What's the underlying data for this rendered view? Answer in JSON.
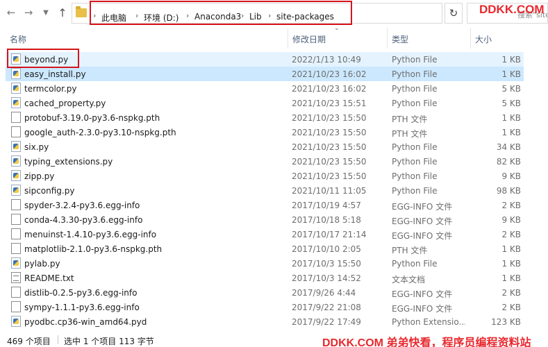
{
  "address_bar": {
    "crumbs": [
      "此电脑",
      "环境 (D:)",
      "Anaconda3",
      "Lib",
      "site-packages"
    ],
    "search_placeholder": "搜索\"site-pa"
  },
  "watermark_top": "DDKK.COM",
  "columns": {
    "name": "名称",
    "date": "修改日期",
    "type": "类型",
    "size": "大小"
  },
  "files": [
    {
      "name": "beyond.py",
      "date": "2022/1/13 10:49",
      "type": "Python File",
      "size": "1 KB",
      "icon": "python-file-icon",
      "state": "hover"
    },
    {
      "name": "easy_install.py",
      "date": "2021/10/23 16:02",
      "type": "Python File",
      "size": "1 KB",
      "icon": "python-file-icon",
      "state": "selected"
    },
    {
      "name": "termcolor.py",
      "date": "2021/10/23 16:02",
      "type": "Python File",
      "size": "5 KB",
      "icon": "python-file-icon"
    },
    {
      "name": "cached_property.py",
      "date": "2021/10/23 15:51",
      "type": "Python File",
      "size": "5 KB",
      "icon": "python-file-icon"
    },
    {
      "name": "protobuf-3.19.0-py3.6-nspkg.pth",
      "date": "2021/10/23 15:50",
      "type": "PTH 文件",
      "size": "1 KB",
      "icon": "blank-file-icon"
    },
    {
      "name": "google_auth-2.3.0-py3.10-nspkg.pth",
      "date": "2021/10/23 15:50",
      "type": "PTH 文件",
      "size": "1 KB",
      "icon": "blank-file-icon"
    },
    {
      "name": "six.py",
      "date": "2021/10/23 15:50",
      "type": "Python File",
      "size": "34 KB",
      "icon": "python-file-icon"
    },
    {
      "name": "typing_extensions.py",
      "date": "2021/10/23 15:50",
      "type": "Python File",
      "size": "82 KB",
      "icon": "python-file-icon"
    },
    {
      "name": "zipp.py",
      "date": "2021/10/23 15:50",
      "type": "Python File",
      "size": "9 KB",
      "icon": "python-file-icon"
    },
    {
      "name": "sipconfig.py",
      "date": "2021/10/11 11:05",
      "type": "Python File",
      "size": "98 KB",
      "icon": "python-file-icon"
    },
    {
      "name": "spyder-3.2.4-py3.6.egg-info",
      "date": "2017/10/19 4:57",
      "type": "EGG-INFO 文件",
      "size": "2 KB",
      "icon": "blank-file-icon"
    },
    {
      "name": "conda-4.3.30-py3.6.egg-info",
      "date": "2017/10/18 5:18",
      "type": "EGG-INFO 文件",
      "size": "9 KB",
      "icon": "blank-file-icon"
    },
    {
      "name": "menuinst-1.4.10-py3.6.egg-info",
      "date": "2017/10/17 21:14",
      "type": "EGG-INFO 文件",
      "size": "2 KB",
      "icon": "blank-file-icon"
    },
    {
      "name": "matplotlib-2.1.0-py3.6-nspkg.pth",
      "date": "2017/10/10 2:05",
      "type": "PTH 文件",
      "size": "1 KB",
      "icon": "blank-file-icon"
    },
    {
      "name": "pylab.py",
      "date": "2017/10/3 15:50",
      "type": "Python File",
      "size": "1 KB",
      "icon": "python-file-icon"
    },
    {
      "name": "README.txt",
      "date": "2017/10/3 14:52",
      "type": "文本文档",
      "size": "1 KB",
      "icon": "text-file-icon"
    },
    {
      "name": "distlib-0.2.5-py3.6.egg-info",
      "date": "2017/9/26 4:44",
      "type": "EGG-INFO 文件",
      "size": "2 KB",
      "icon": "blank-file-icon"
    },
    {
      "name": "sympy-1.1.1-py3.6.egg-info",
      "date": "2017/9/22 21:08",
      "type": "EGG-INFO 文件",
      "size": "2 KB",
      "icon": "blank-file-icon"
    },
    {
      "name": "pyodbc.cp36-win_amd64.pyd",
      "date": "2017/9/22 17:49",
      "type": "Python Extensio...",
      "size": "123 KB",
      "icon": "python-file-icon"
    }
  ],
  "status": {
    "count": "469 个项目",
    "selection": "选中 1 个项目  113 字节"
  },
  "watermark_bottom": "DDKK.COM 弟弟快看，程序员编程资料站",
  "colors": {
    "highlight_box": "#d6141b",
    "selected_row": "#cce8ff",
    "hover_row": "#e5f3ff",
    "watermark": "#e8282e"
  }
}
